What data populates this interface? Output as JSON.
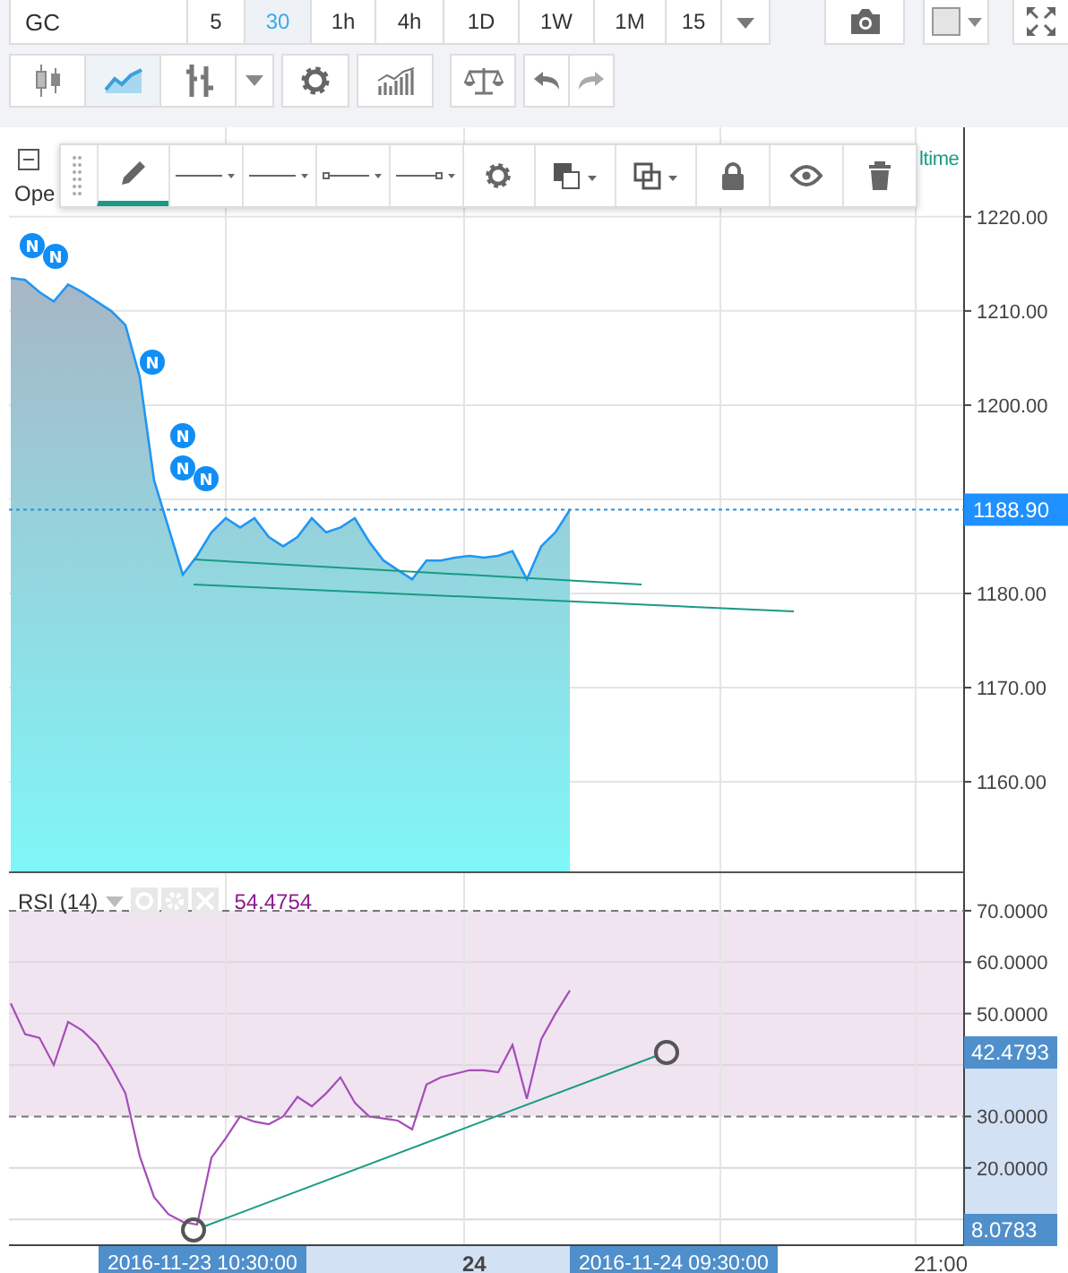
{
  "symbol": "GC",
  "timeframes": [
    {
      "label": "5",
      "selected": false
    },
    {
      "label": "30",
      "selected": true
    },
    {
      "label": "1h",
      "selected": false
    },
    {
      "label": "4h",
      "selected": false
    },
    {
      "label": "1D",
      "selected": false
    },
    {
      "label": "1W",
      "selected": false
    },
    {
      "label": "1M",
      "selected": false
    },
    {
      "label": "15",
      "selected": false
    }
  ],
  "chart_types": [
    {
      "kind": "candles",
      "selected": false
    },
    {
      "kind": "area",
      "selected": true
    },
    {
      "kind": "bars",
      "selected": false
    }
  ],
  "legend": {
    "text": "Ope",
    "right_text": "ltime"
  },
  "drawing_toolbar": {
    "pencil": {
      "selected": true
    }
  },
  "price_chart": {
    "last_price": "1188.90",
    "news_markers": [
      {
        "label": "N"
      },
      {
        "label": "N"
      },
      {
        "label": "N"
      },
      {
        "label": "N"
      },
      {
        "label": "N"
      },
      {
        "label": "N"
      }
    ],
    "chart_data": {
      "type": "area",
      "ylim": [
        1150.3,
        1229.5
      ],
      "grid": true,
      "yticks": [
        {
          "value": 1160,
          "label": "1160.00"
        },
        {
          "value": 1170,
          "label": "1170.00"
        },
        {
          "value": 1180,
          "label": "1180.00"
        },
        {
          "value": 1200,
          "label": "1200.00"
        },
        {
          "value": 1210,
          "label": "1210.00"
        },
        {
          "value": 1220,
          "label": "1220.00"
        }
      ],
      "values": [
        1213.5,
        1213.3,
        1212,
        1211,
        1212.8,
        1212,
        1211,
        1210,
        1208.5,
        1203,
        1192,
        1187,
        1182,
        1184,
        1186.5,
        1188,
        1187,
        1188,
        1186,
        1185,
        1186,
        1188,
        1186.5,
        1187,
        1188,
        1185.5,
        1183.5,
        1182.5,
        1181.5,
        1183.5,
        1183.5,
        1183.8,
        1184,
        1183.8,
        1184,
        1184.5,
        1181.5,
        1185,
        1186.5,
        1188.9
      ]
    }
  },
  "rsi": {
    "title": "RSI (14)",
    "value": "54.4754",
    "trend_labels": [
      "42.4793",
      "8.0783"
    ],
    "chart_data": {
      "type": "line",
      "ylim": [
        4.8,
        77.3
      ],
      "grid": true,
      "yticks": [
        {
          "value": 20,
          "label": "20.0000"
        },
        {
          "value": 30,
          "label": "30.0000"
        },
        {
          "value": 50,
          "label": "50.0000"
        },
        {
          "value": 60,
          "label": "60.0000"
        },
        {
          "value": 70,
          "label": "70.0000"
        }
      ],
      "values": [
        52,
        46,
        45.3,
        40,
        48.4,
        46.7,
        44,
        39.7,
        34.5,
        22.3,
        14.3,
        11,
        9.5,
        9,
        22,
        25.8,
        30,
        29,
        28.5,
        30,
        33.8,
        32,
        34.5,
        37.6,
        32.7,
        30,
        29.6,
        29.2,
        27.5,
        36.2,
        37.6,
        38.3,
        39,
        39,
        38.6,
        43.9,
        33.4,
        45,
        50,
        54.5
      ]
    }
  },
  "time_axis": {
    "crosshair_labels": [
      "2016-11-23 10:30:00",
      "2016-11-24 09:30:00"
    ],
    "ticks": [
      "24",
      "21:00"
    ]
  }
}
